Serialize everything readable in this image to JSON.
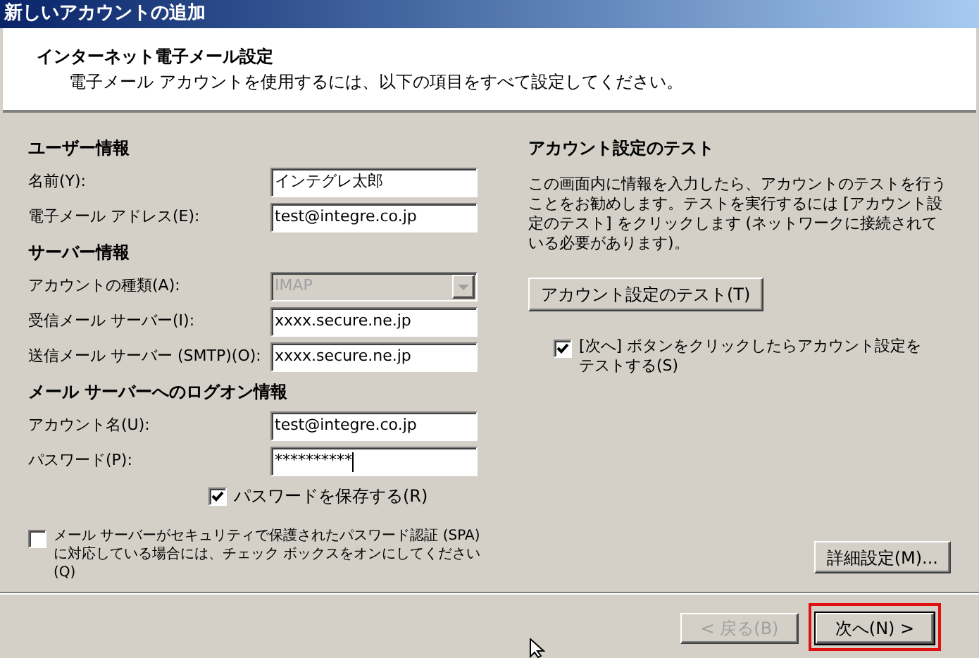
{
  "window": {
    "title": "新しいアカウントの追加"
  },
  "header": {
    "title": "インターネット電子メール設定",
    "subtitle": "電子メール アカウントを使用するには、以下の項目をすべて設定してください。"
  },
  "sections": [
    {
      "heading": "ユーザー情報",
      "fields": [
        {
          "kind": "text",
          "label": "名前(Y):",
          "value": "インテグレ太郎",
          "disabled": false
        },
        {
          "kind": "text",
          "label": "電子メール アドレス(E):",
          "value": "test@integre.co.jp",
          "disabled": false
        }
      ]
    },
    {
      "heading": "サーバー情報",
      "fields": [
        {
          "kind": "dropdown",
          "label": "アカウントの種類(A):",
          "value": "IMAP",
          "disabled": true
        },
        {
          "kind": "text",
          "label": "受信メール サーバー(I):",
          "value": "xxxx.secure.ne.jp",
          "disabled": false
        },
        {
          "kind": "text",
          "label": "送信メール サーバー (SMTP)(O):",
          "value": "xxxx.secure.ne.jp",
          "disabled": false
        }
      ]
    },
    {
      "heading": "メール サーバーへのログオン情報",
      "fields": [
        {
          "kind": "text",
          "label": "アカウント名(U):",
          "value": "test@integre.co.jp",
          "disabled": false
        },
        {
          "kind": "password",
          "label": "パスワード(P):",
          "value": "**********",
          "disabled": false
        }
      ]
    }
  ],
  "save_password": {
    "label": "パスワードを保存する(R)",
    "checked": true
  },
  "spa": {
    "label": "メール サーバーがセキュリティで保護されたパスワード認証 (SPA) に対応している場合には、チェック ボックスをオンにしてください(Q)",
    "checked": false
  },
  "test": {
    "heading": "アカウント設定のテスト",
    "description": "この画面内に情報を入力したら、アカウントのテストを行うことをお勧めします。テストを実行するには [アカウント設定のテスト] をクリックします (ネットワークに接続されている必要があります)。",
    "button": "アカウント設定のテスト(T)",
    "checkbox": {
      "label": "[次へ] ボタンをクリックしたらアカウント設定をテストする(S)",
      "checked": true
    }
  },
  "more_settings": "詳細設定(M)...",
  "buttons": [
    {
      "label": "< 戻る(B)",
      "disabled": true,
      "highlighted": false
    },
    {
      "label": "次へ(N) >",
      "disabled": false,
      "highlighted": true
    }
  ]
}
